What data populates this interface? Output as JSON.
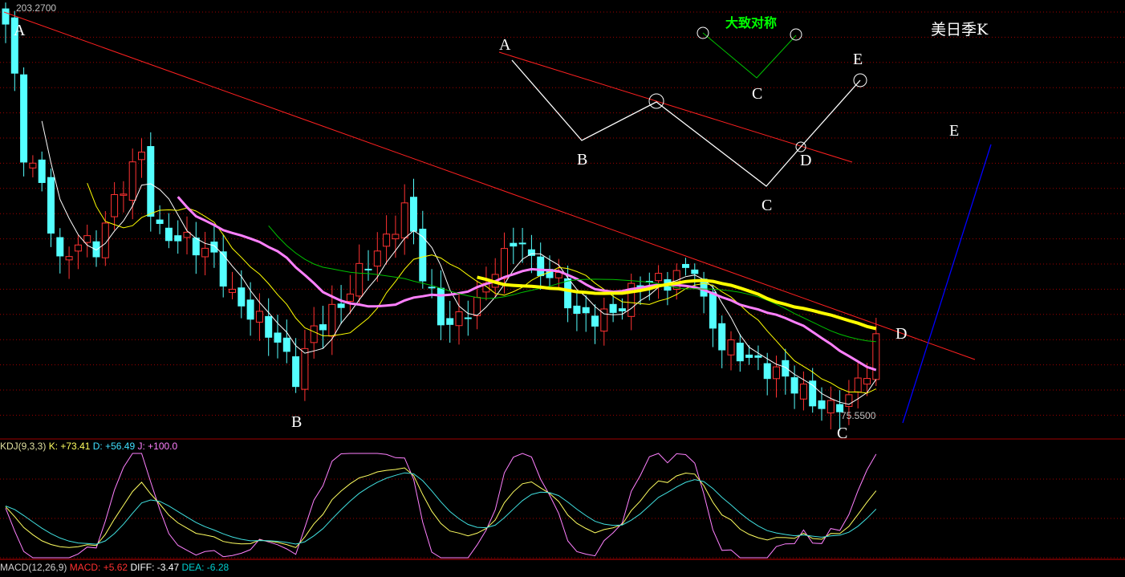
{
  "chart_data": {
    "type": "candlestick",
    "title": "美日季K",
    "price_max_label": "203.2700",
    "price_min_label": "75.5500",
    "price_range": [
      75.55,
      203.27
    ],
    "candle_count": 97,
    "close_keypoints": [
      [
        0,
        198.2
      ],
      [
        1,
        180.5
      ],
      [
        2,
        157.7
      ],
      [
        4,
        147.6
      ],
      [
        6,
        122.3
      ],
      [
        8,
        129.9
      ],
      [
        10,
        127.4
      ],
      [
        12,
        142.6
      ],
      [
        15,
        157.7
      ],
      [
        16,
        140.0
      ],
      [
        17,
        132.4
      ],
      [
        20,
        129.9
      ],
      [
        23,
        124.9
      ],
      [
        25,
        112.2
      ],
      [
        28,
        104.7
      ],
      [
        30,
        98.3
      ],
      [
        32,
        86.9
      ],
      [
        34,
        102.1
      ],
      [
        37,
        109.7
      ],
      [
        39,
        119.8
      ],
      [
        42,
        129.9
      ],
      [
        44,
        140.0
      ],
      [
        45,
        132.4
      ],
      [
        46,
        119.8
      ],
      [
        48,
        104.7
      ],
      [
        50,
        104.7
      ],
      [
        53,
        114.8
      ],
      [
        54,
        122.3
      ],
      [
        57,
        131.2
      ],
      [
        58,
        122.3
      ],
      [
        61,
        117.3
      ],
      [
        63,
        105.9
      ],
      [
        66,
        105.9
      ],
      [
        68,
        109.7
      ],
      [
        70,
        117.3
      ],
      [
        73,
        117.3
      ],
      [
        76,
        122.3
      ],
      [
        77,
        109.7
      ],
      [
        79,
        97.0
      ],
      [
        81,
        94.5
      ],
      [
        84,
        89.5
      ],
      [
        86,
        86.9
      ],
      [
        89,
        79.3
      ],
      [
        91,
        76.8
      ],
      [
        93,
        80.6
      ],
      [
        95,
        89.5
      ],
      [
        96,
        98.3
      ]
    ],
    "moving_averages": [
      {
        "period": 5,
        "color": "#ffffff"
      },
      {
        "period": 10,
        "color": "#ffff00"
      },
      {
        "period": 20,
        "color": "#ff80ff"
      },
      {
        "period": 30,
        "color": "#00c000"
      }
    ],
    "wave_labels": {
      "A": "A",
      "B": "B",
      "C": "C",
      "D": "D",
      "E": "E"
    },
    "annotation": "大致对称",
    "kdj": {
      "label": "KDJ(9,3,3)",
      "k": "K: +73.41",
      "d": "D: +56.49",
      "j": "J: +100.0"
    },
    "macd": {
      "label": "MACD(12,26,9)",
      "macd": "MACD: +5.62",
      "diff": "DIFF: -3.47",
      "dea": "DEA: -6.28"
    },
    "colors": {
      "up": "#ff3232",
      "down": "#54ffff",
      "grid": "#a00000",
      "trend": "#ff0000"
    }
  }
}
